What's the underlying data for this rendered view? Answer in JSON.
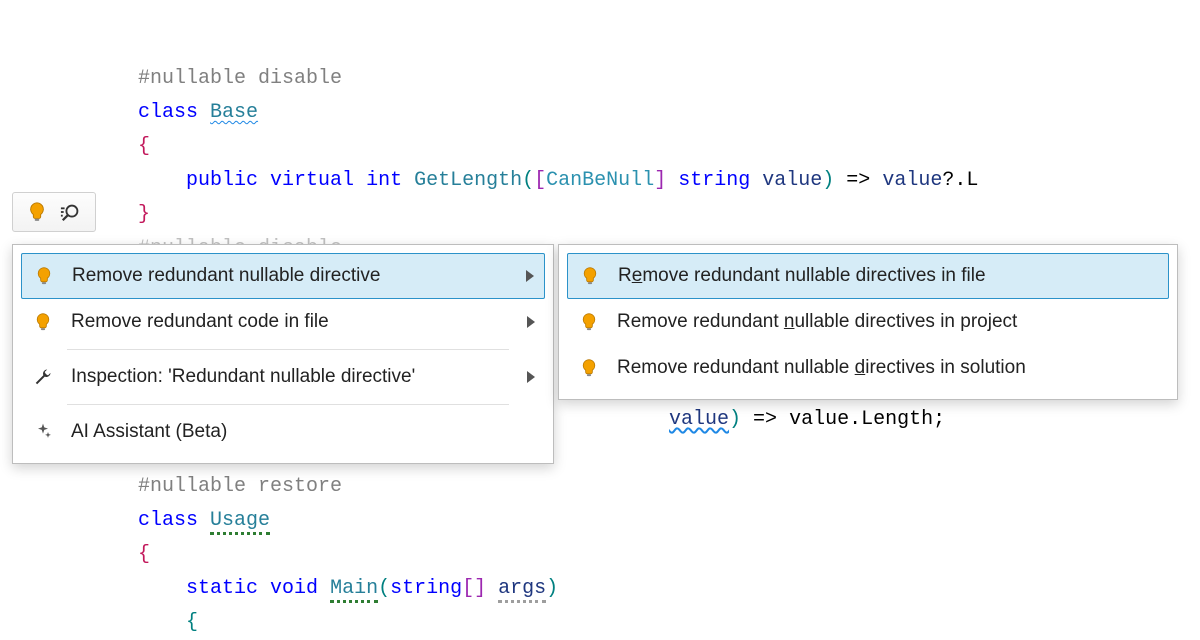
{
  "code": {
    "l1_directive": "#nullable disable",
    "l2_kw": "class",
    "l2_name": "Base",
    "l3_brace": "{",
    "l4_pub": "public",
    "l4_virtual": "virtual",
    "l4_int": "int",
    "l4_method": "GetLength",
    "l4_open": "(",
    "l4_lb": "[",
    "l4_attr": "CanBeNull",
    "l4_rb": "]",
    "l4_str": "string",
    "l4_param": "value",
    "l4_close": ")",
    "l4_arrow": " => ",
    "l4_expr1": "value",
    "l4_expr2": "?.",
    "l4_expr3": "L",
    "l5_brace": "}",
    "l6_directive": "#nullable disable",
    "peek_value": "value",
    "peek_arrow": " => ",
    "peek_expr": "value.Length",
    "l8_directive": "#nullable restore",
    "l9_kw": "class",
    "l9_name": "Usage",
    "l10_brace": "{",
    "l11_static": "static",
    "l11_void": "void",
    "l11_main": "Main",
    "l11_open": "(",
    "l11_str": "string",
    "l11_brk": "[]",
    "l11_args": "args",
    "l11_close": ")",
    "l12_brace": "{"
  },
  "menu": {
    "item1": "Remove redundant nullable directive",
    "item2": "Remove redundant code in file",
    "item3": "Inspection: 'Redundant nullable directive'",
    "item4": "AI Assistant (Beta)"
  },
  "submenu": {
    "s1_pre": "R",
    "s1_mn": "e",
    "s1_post": "move redundant nullable directives in file",
    "s2_pre": "Remove redundant ",
    "s2_mn": "n",
    "s2_post": "ullable directives in project",
    "s3_pre": "Remove redundant nullable ",
    "s3_mn": "d",
    "s3_post": "irectives in solution"
  }
}
